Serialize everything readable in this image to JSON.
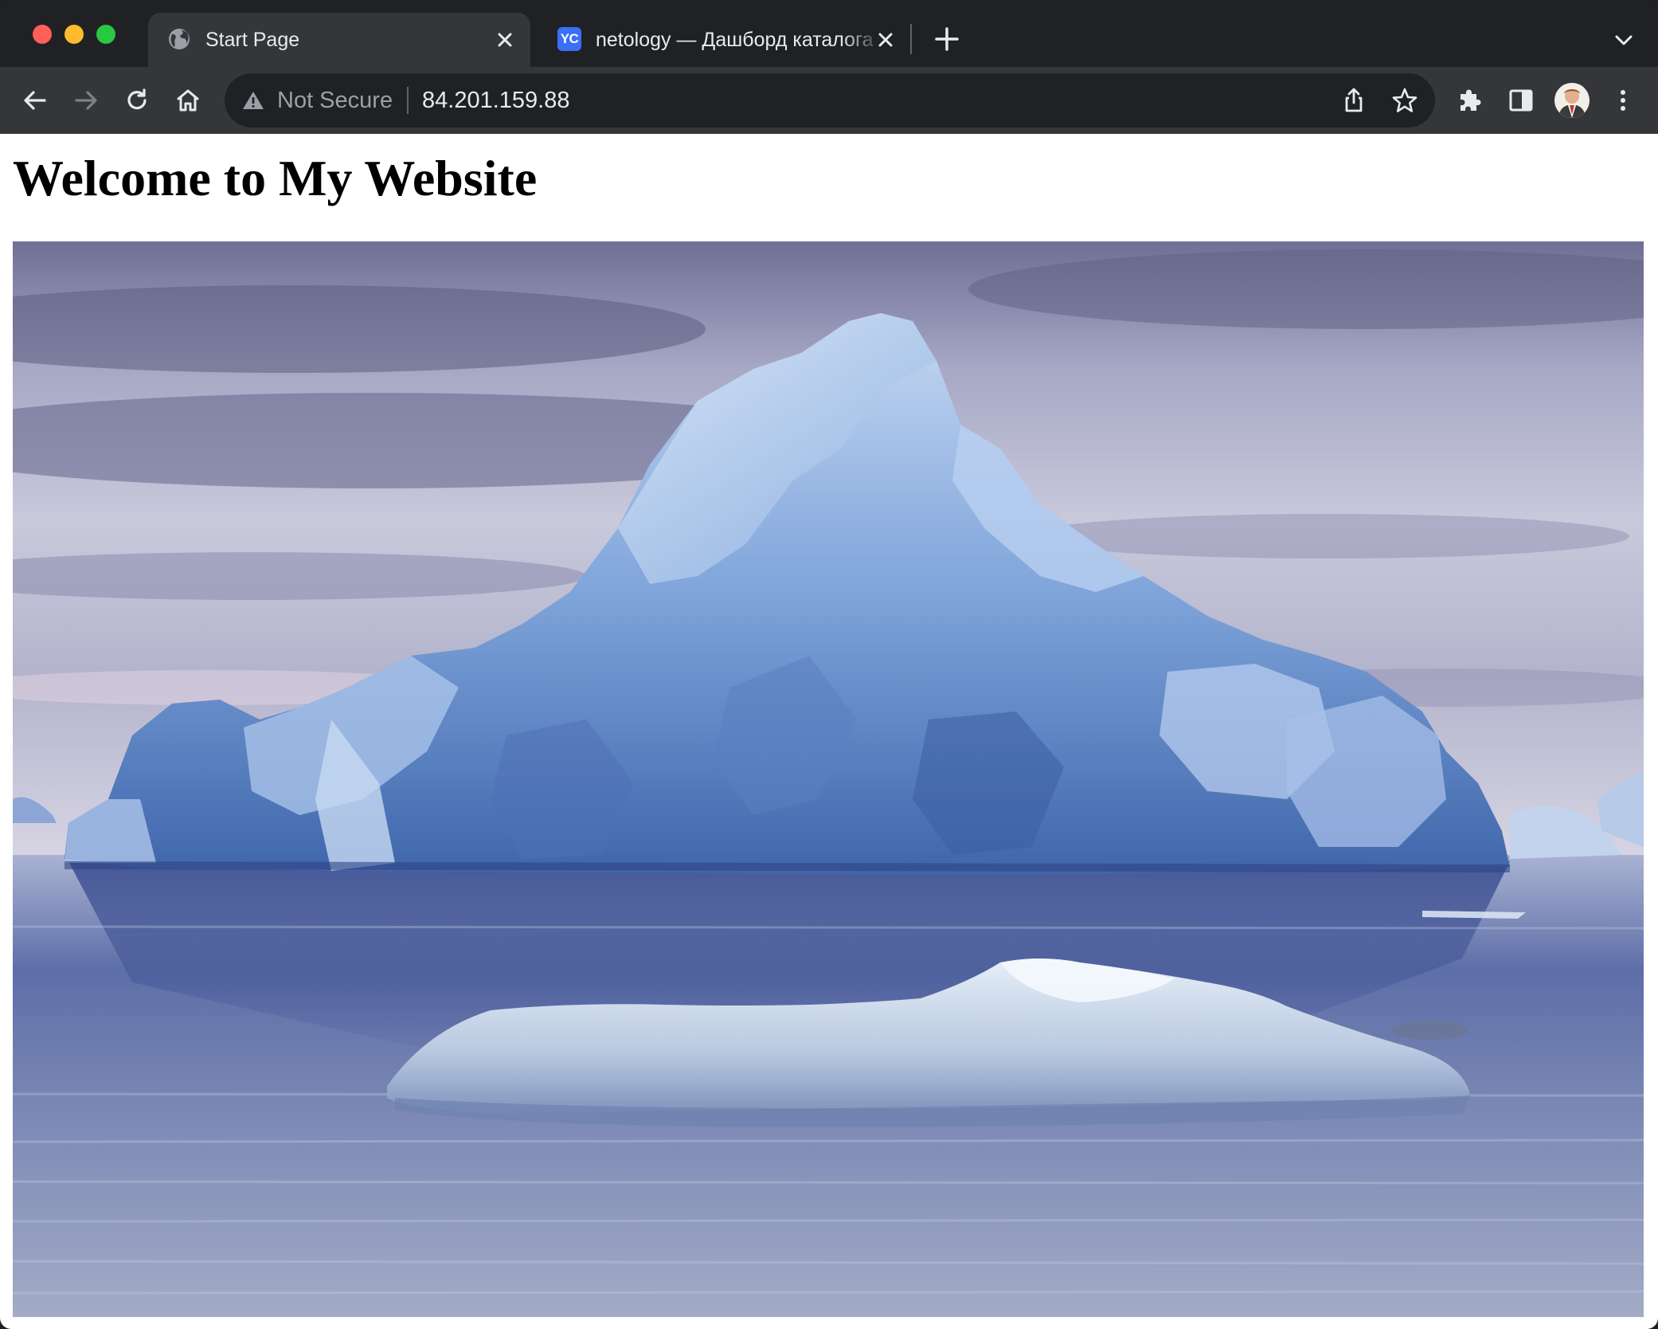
{
  "browser": {
    "tabs": [
      {
        "title": "Start Page",
        "favicon": "globe-icon",
        "active": true
      },
      {
        "title": "netology — Дашборд каталога",
        "favicon_text": "YC",
        "active": false
      }
    ],
    "toolbar": {
      "security_label": "Not Secure",
      "url": "84.201.159.88"
    },
    "colors": {
      "frame": "#202124",
      "toolbar": "#35363a",
      "text": "#e8eaed",
      "muted": "#9aa0a6",
      "yc_favicon": "#3a6ff7"
    }
  },
  "page": {
    "heading": "Welcome to My Website",
    "image": {
      "subject": "iceberg-photo"
    }
  }
}
